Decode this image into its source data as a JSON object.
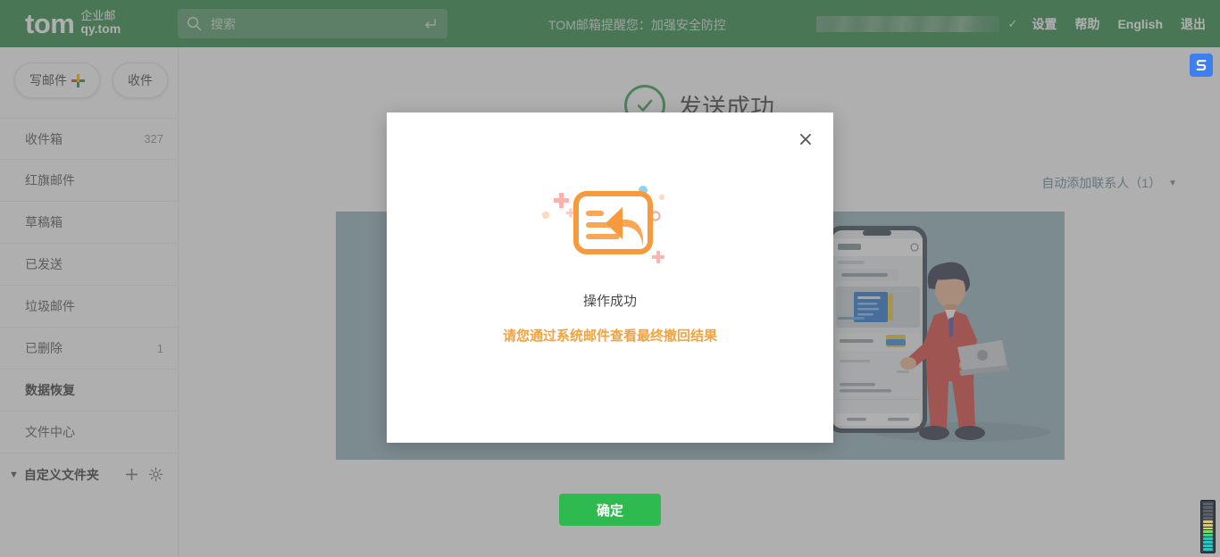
{
  "header": {
    "logo_main": "tom",
    "logo_cn": "企业邮",
    "logo_domain": "qy.tom",
    "search": {
      "placeholder": "搜索",
      "value": "",
      "icon": "search-icon",
      "enter_icon": "enter-key-icon"
    },
    "notice": "TOM邮箱提醒您：加强安全防控",
    "user_account": "",
    "user_caret": "✓",
    "links": [
      {
        "label": "设置",
        "name": "settings-link"
      },
      {
        "label": "帮助",
        "name": "help-link"
      },
      {
        "label": "English",
        "name": "english-link"
      },
      {
        "label": "退出",
        "name": "logout-link"
      }
    ],
    "brand_color": "#1e8039"
  },
  "sidebar": {
    "compose_label": "写邮件",
    "receive_label": "收件",
    "folders": [
      {
        "label": "收件箱",
        "count": "327",
        "active": false
      },
      {
        "label": "红旗邮件",
        "count": "",
        "active": false
      },
      {
        "label": "草稿箱",
        "count": "",
        "active": false
      },
      {
        "label": "已发送",
        "count": "",
        "active": false
      },
      {
        "label": "垃圾邮件",
        "count": "",
        "active": false
      },
      {
        "label": "已删除",
        "count": "1",
        "active": false
      },
      {
        "label": "数据恢复",
        "count": "",
        "active": true
      },
      {
        "label": "文件中心",
        "count": "",
        "active": false
      }
    ],
    "custom_folder_label": "自定义文件夹",
    "custom_folder_caret": "▼",
    "custom_folder_add": "+",
    "custom_folder_settings": "gear-icon"
  },
  "main": {
    "success_title": "发送成功",
    "auto_contact_label": "自动添加联系人（1）",
    "banner_color": "#8fb0b9"
  },
  "modal": {
    "close_label": "×",
    "icon_name": "mail-recall-icon",
    "message": "操作成功",
    "submessage": "请您通过系统邮件查看最终撤回结果",
    "confirm_label": "确定",
    "confirm_color": "#2eba4e",
    "submessage_color": "#f3a23c"
  },
  "floating": {
    "extension_icon": "browser-extension-icon",
    "meter_icon": "level-meter-icon"
  }
}
